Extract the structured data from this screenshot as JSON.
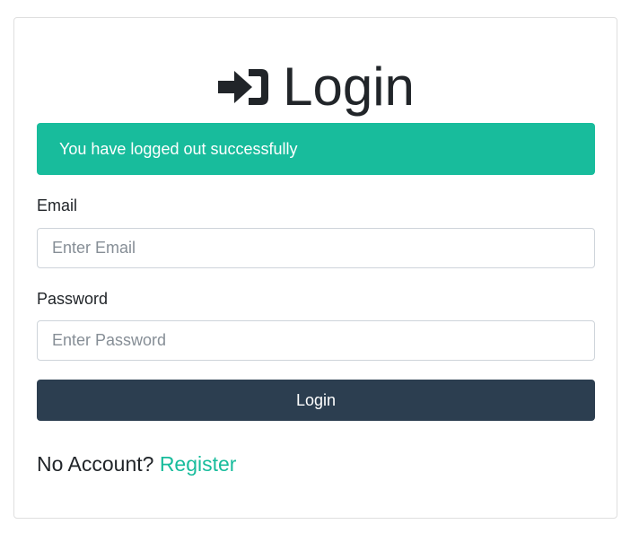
{
  "heading": {
    "icon": "sign-in-icon",
    "title": "Login"
  },
  "alert": {
    "message": "You have logged out successfully",
    "color": "#18bc9c"
  },
  "form": {
    "email_label": "Email",
    "email_placeholder": "Enter Email",
    "email_value": "",
    "password_label": "Password",
    "password_placeholder": "Enter Password",
    "password_value": "",
    "submit_label": "Login"
  },
  "footer": {
    "prompt": "No Account?",
    "register_link": "Register"
  },
  "colors": {
    "accent": "#18bc9c",
    "button": "#2c3e50"
  }
}
